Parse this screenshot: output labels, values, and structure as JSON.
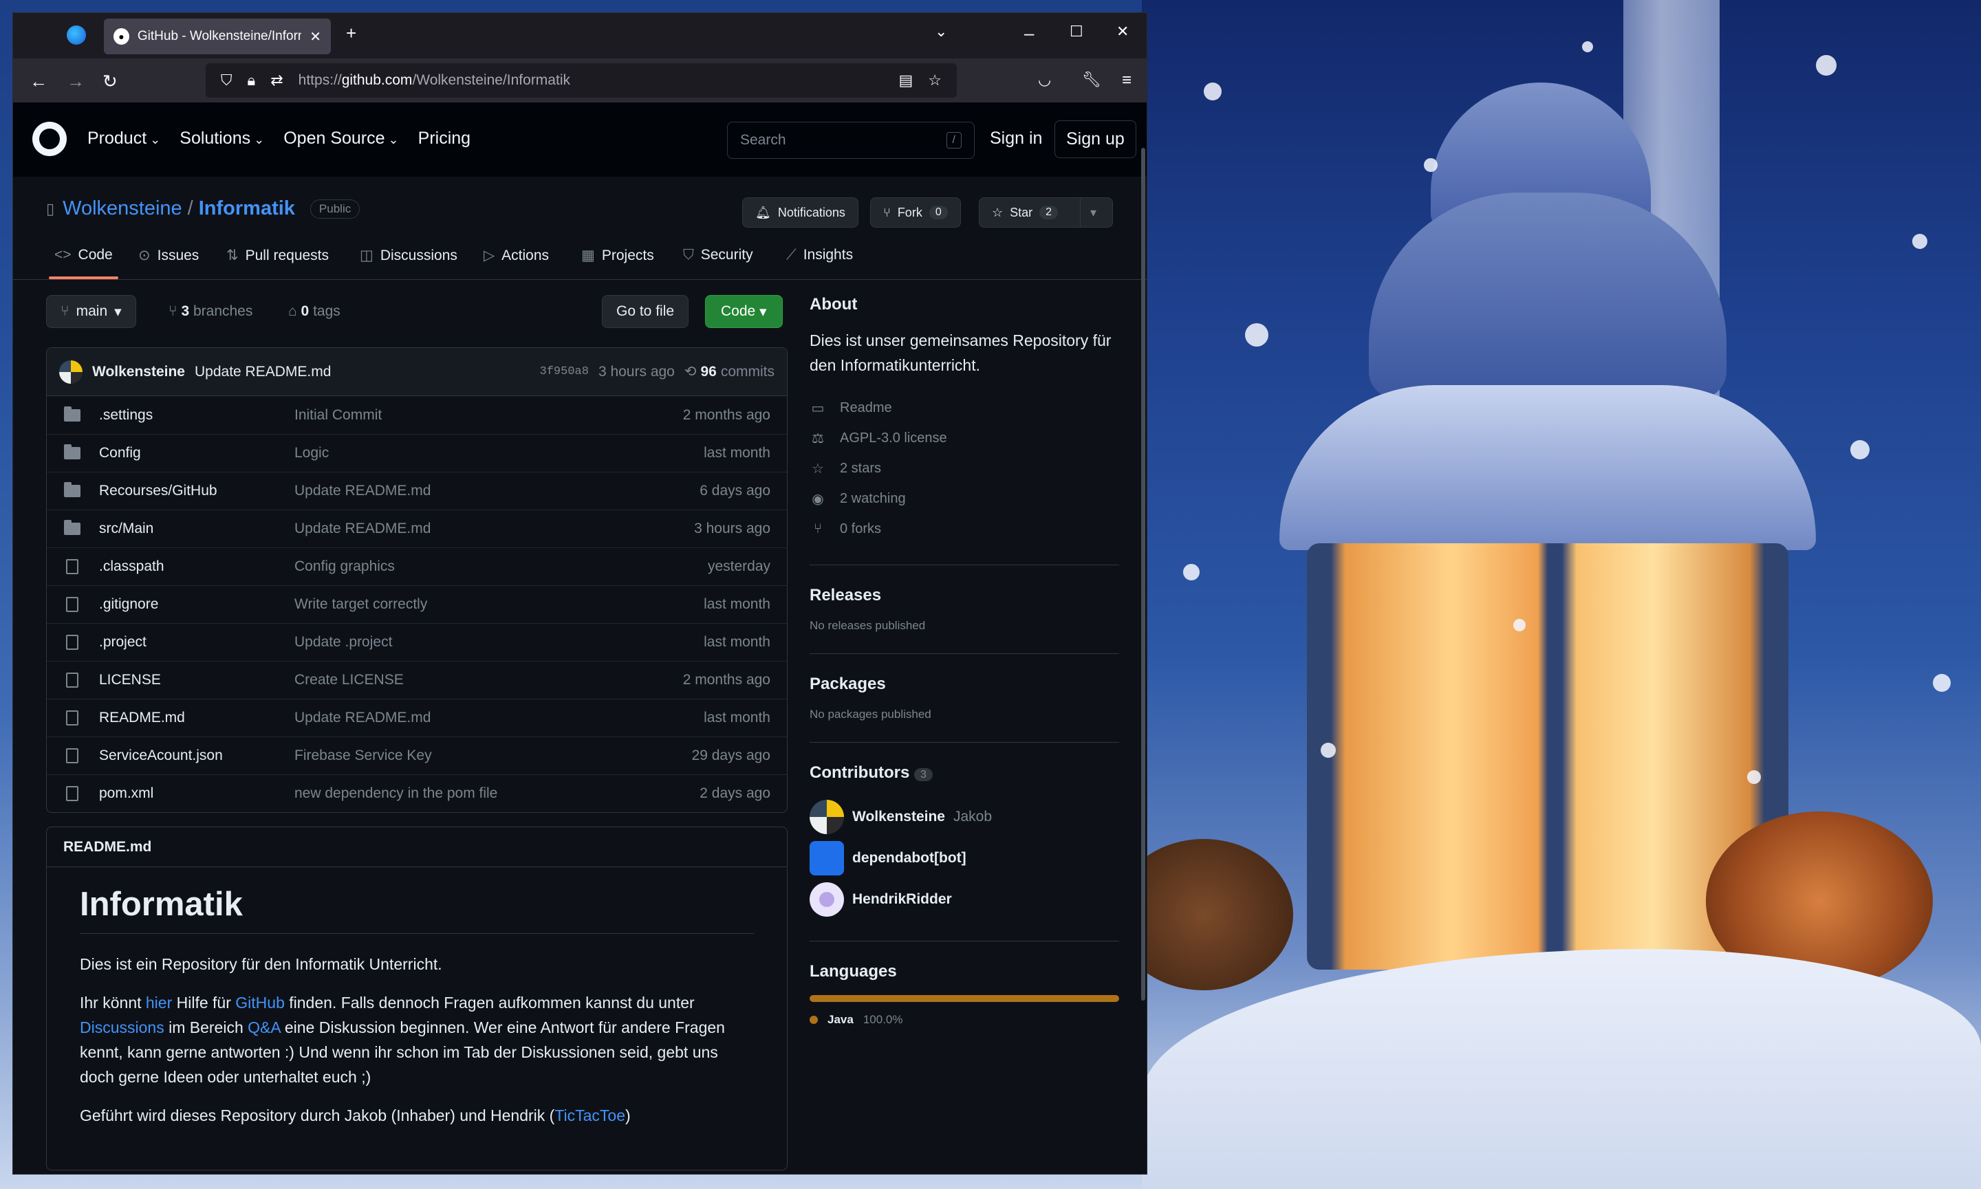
{
  "browser": {
    "tab_title": "GitHub - Wolkensteine/Informatik",
    "url_prefix": "https://",
    "url_domain": "github.com",
    "url_path": "/Wolkensteine/Informatik"
  },
  "header": {
    "nav": [
      "Product",
      "Solutions",
      "Open Source",
      "Pricing"
    ],
    "search_placeholder": "Search",
    "search_shortcut": "/",
    "sign_in": "Sign in",
    "sign_up": "Sign up"
  },
  "repo": {
    "owner": "Wolkensteine",
    "separator": "/",
    "name": "Informatik",
    "visibility": "Public",
    "notifications": "Notifications",
    "fork_label": "Fork",
    "fork_count": "0",
    "star_label": "Star",
    "star_count": "2"
  },
  "tabs": [
    "Code",
    "Issues",
    "Pull requests",
    "Discussions",
    "Actions",
    "Projects",
    "Security",
    "Insights"
  ],
  "branchbar": {
    "branch": "main",
    "branches_count": "3",
    "branches_label": "branches",
    "tags_count": "0",
    "tags_label": "tags",
    "go_to_file": "Go to file",
    "code": "Code"
  },
  "last_commit": {
    "author": "Wolkensteine",
    "message": "Update README.md",
    "sha": "3f950a8",
    "age": "3 hours ago",
    "count": "96",
    "count_label": "commits"
  },
  "files": [
    {
      "type": "dir",
      "name": ".settings",
      "message": "Initial Commit",
      "age": "2 months ago"
    },
    {
      "type": "dir",
      "name": "Config",
      "message": "Logic",
      "age": "last month"
    },
    {
      "type": "dir",
      "name": "Recourses/GitHub",
      "message": "Update README.md",
      "age": "6 days ago"
    },
    {
      "type": "dir",
      "name": "src/Main",
      "message": "Update README.md",
      "age": "3 hours ago"
    },
    {
      "type": "file",
      "name": ".classpath",
      "message": "Config graphics",
      "age": "yesterday"
    },
    {
      "type": "file",
      "name": ".gitignore",
      "message": "Write target correctly",
      "age": "last month"
    },
    {
      "type": "file",
      "name": ".project",
      "message": "Update .project",
      "age": "last month"
    },
    {
      "type": "file",
      "name": "LICENSE",
      "message": "Create LICENSE",
      "age": "2 months ago"
    },
    {
      "type": "file",
      "name": "README.md",
      "message": "Update README.md",
      "age": "last month"
    },
    {
      "type": "file",
      "name": "ServiceAcount.json",
      "message": "Firebase Service Key",
      "age": "29 days ago"
    },
    {
      "type": "file",
      "name": "pom.xml",
      "message": "new dependency in the pom file",
      "age": "2 days ago"
    }
  ],
  "readme": {
    "filename": "README.md",
    "title": "Informatik",
    "p1": "Dies ist ein Repository für den Informatik Unterricht.",
    "p2_a": "Ihr könnt ",
    "p2_link1": "hier",
    "p2_b": " Hilfe für ",
    "p2_link2": "GitHub",
    "p2_c": " finden. Falls dennoch Fragen aufkommen kannst du unter ",
    "p2_link3": "Discussions",
    "p2_d": " im Bereich ",
    "p2_link4": "Q&A",
    "p2_e": " eine Diskussion beginnen. Wer eine Antwort für andere Fragen kennt, kann gerne antworten :) Und wenn ihr schon im Tab der Diskussionen seid, gebt uns doch gerne Ideen oder unterhaltet euch ;)",
    "p3_a": "Geführt wird dieses Repository durch Jakob (Inhaber) und Hendrik (",
    "p3_link": "TicTacToe",
    "p3_b": ")"
  },
  "about": {
    "heading": "About",
    "description": "Dies ist unser gemeinsames Repository für den Informatikunterricht.",
    "items": [
      "Readme",
      "AGPL-3.0 license",
      "2 stars",
      "2 watching",
      "0 forks"
    ]
  },
  "releases": {
    "heading": "Releases",
    "text": "No releases published"
  },
  "packages": {
    "heading": "Packages",
    "text": "No packages published"
  },
  "contributors": {
    "heading": "Contributors",
    "count": "3",
    "list": [
      {
        "name": "Wolkensteine",
        "sub": "Jakob"
      },
      {
        "name": "dependabot[bot]",
        "sub": ""
      },
      {
        "name": "HendrikRidder",
        "sub": ""
      }
    ]
  },
  "languages": {
    "heading": "Languages",
    "items": [
      {
        "name": "Java",
        "percent": "100.0%",
        "fraction": 1.0,
        "color": "#b07219"
      }
    ]
  }
}
